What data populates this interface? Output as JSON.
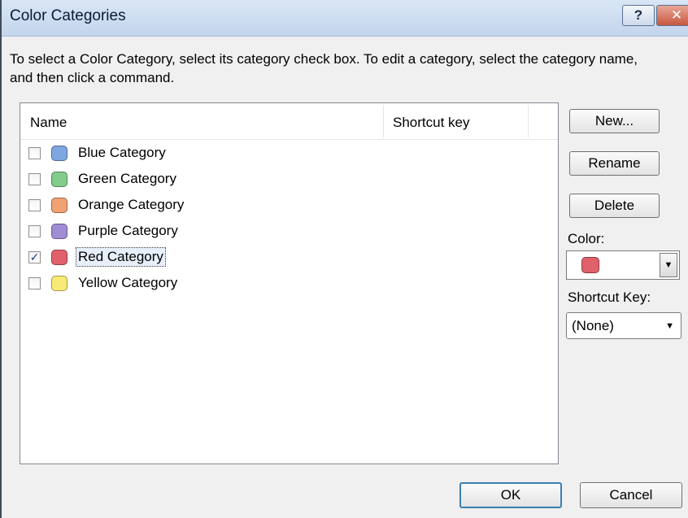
{
  "window": {
    "title": "Color Categories",
    "help_glyph": "?",
    "close_glyph": "✕"
  },
  "instructions": "To select a Color Category, select its category check box.  To edit a category, select the category name, and then click a command.",
  "list": {
    "columns": [
      "Name",
      "Shortcut key"
    ],
    "categories": [
      {
        "label": "Blue Category",
        "checked": false,
        "color": "#7ea6e0",
        "shortcut": ""
      },
      {
        "label": "Green Category",
        "checked": false,
        "color": "#82cc8c",
        "shortcut": ""
      },
      {
        "label": "Orange Category",
        "checked": false,
        "color": "#f2a172",
        "shortcut": ""
      },
      {
        "label": "Purple Category",
        "checked": false,
        "color": "#9f8dd4",
        "shortcut": ""
      },
      {
        "label": "Red Category",
        "checked": true,
        "selected": true,
        "color": "#e0616b",
        "shortcut": ""
      },
      {
        "label": "Yellow Category",
        "checked": false,
        "color": "#f7ea77",
        "shortcut": ""
      }
    ]
  },
  "side_panel": {
    "new_label": "New...",
    "rename_label": "Rename",
    "delete_label": "Delete",
    "color_label": "Color:",
    "selected_color": "#e0616b",
    "shortcut_label": "Shortcut Key:",
    "shortcut_value": "(None)"
  },
  "footer": {
    "ok_label": "OK",
    "cancel_label": "Cancel"
  }
}
